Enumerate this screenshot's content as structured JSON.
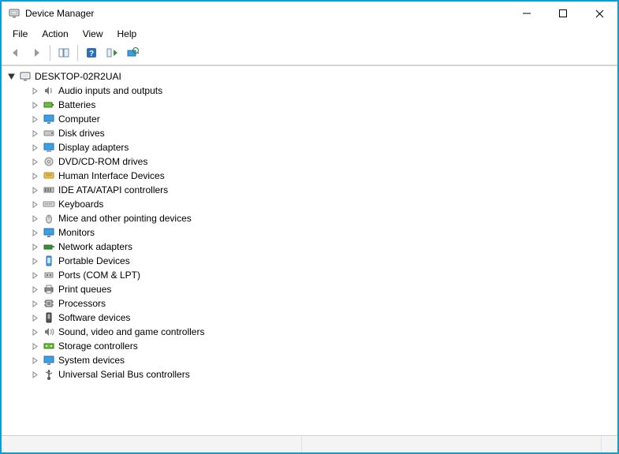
{
  "window": {
    "title": "Device Manager",
    "icon": "device-manager-icon"
  },
  "menu": {
    "file": "File",
    "action": "Action",
    "view": "View",
    "help": "Help"
  },
  "toolbar": {
    "back": "back-arrow-icon",
    "forward": "forward-arrow-icon",
    "show_hide": "show-hide-console-icon",
    "help": "help-icon",
    "properties": "properties-icon",
    "scan": "scan-hardware-icon"
  },
  "tree": {
    "root": {
      "label": "DESKTOP-02R2UAI",
      "icon": "computer-root-icon",
      "expanded": true
    },
    "items": [
      {
        "label": "Audio inputs and outputs",
        "icon": "audio-icon"
      },
      {
        "label": "Batteries",
        "icon": "battery-icon"
      },
      {
        "label": "Computer",
        "icon": "monitor-icon"
      },
      {
        "label": "Disk drives",
        "icon": "disk-icon"
      },
      {
        "label": "Display adapters",
        "icon": "display-adapter-icon"
      },
      {
        "label": "DVD/CD-ROM drives",
        "icon": "optical-drive-icon"
      },
      {
        "label": "Human Interface Devices",
        "icon": "hid-icon"
      },
      {
        "label": "IDE ATA/ATAPI controllers",
        "icon": "ide-icon"
      },
      {
        "label": "Keyboards",
        "icon": "keyboard-icon"
      },
      {
        "label": "Mice and other pointing devices",
        "icon": "mouse-icon"
      },
      {
        "label": "Monitors",
        "icon": "monitor-icon"
      },
      {
        "label": "Network adapters",
        "icon": "network-adapter-icon"
      },
      {
        "label": "Portable Devices",
        "icon": "portable-device-icon"
      },
      {
        "label": "Ports (COM & LPT)",
        "icon": "port-icon"
      },
      {
        "label": "Print queues",
        "icon": "printer-icon"
      },
      {
        "label": "Processors",
        "icon": "cpu-icon"
      },
      {
        "label": "Software devices",
        "icon": "software-device-icon"
      },
      {
        "label": "Sound, video and game controllers",
        "icon": "sound-controller-icon"
      },
      {
        "label": "Storage controllers",
        "icon": "storage-controller-icon"
      },
      {
        "label": "System devices",
        "icon": "system-device-icon"
      },
      {
        "label": "Universal Serial Bus controllers",
        "icon": "usb-icon"
      }
    ]
  }
}
